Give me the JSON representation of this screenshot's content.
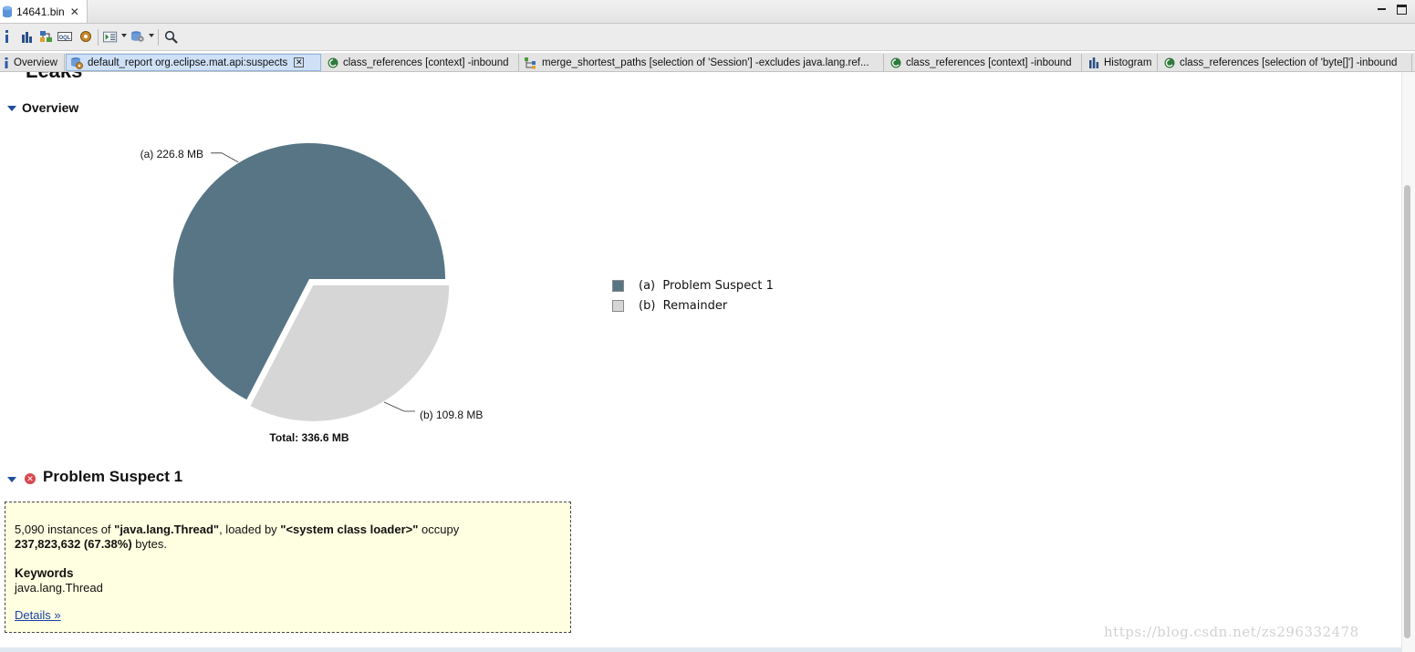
{
  "editor": {
    "tab_title": "14641.bin"
  },
  "toolbar": {
    "info_icon": "info-icon",
    "items": [
      "histogram-icon",
      "dominator-tree-icon",
      "oql-icon",
      "heap-dump-overview-icon",
      "run-report-icon",
      "query-browser-icon",
      "search-icon"
    ]
  },
  "subtabs": [
    {
      "label": "Overview",
      "icon": "info-icon",
      "active": false
    },
    {
      "label": "default_report  org.eclipse.mat.api:suspects",
      "icon": "report-gear-icon",
      "active": true
    },
    {
      "label": "class_references [context] -inbound",
      "icon": "class-icon",
      "active": false
    },
    {
      "label": "merge_shortest_paths [selection of 'Session'] -excludes java.lang.ref...",
      "icon": "tree-icon",
      "active": false
    },
    {
      "label": "class_references [context] -inbound",
      "icon": "class-icon",
      "active": false
    },
    {
      "label": "Histogram",
      "icon": "histogram-icon",
      "active": false
    },
    {
      "label": "class_references [selection of 'byte[]'] -inbound",
      "icon": "class-icon",
      "active": false
    }
  ],
  "report": {
    "leaks_title": "Leaks",
    "overview_title": "Overview",
    "chart_data": {
      "type": "pie",
      "title": "",
      "total_label": "Total: 336.6 MB",
      "slices": [
        {
          "key": "(a)",
          "name": "Problem Suspect 1",
          "value": 226.8,
          "label": "(a)  226.8 MB",
          "color": "#587585"
        },
        {
          "key": "(b)",
          "name": "Remainder",
          "value": 109.8,
          "label": "(b)  109.8 MB",
          "color": "#d6d6d6"
        }
      ],
      "unit": "MB",
      "legend_placement": "right"
    },
    "legend": [
      {
        "key": "(a)",
        "name": "Problem Suspect 1",
        "color": "#587585"
      },
      {
        "key": "(b)",
        "name": "Remainder",
        "color": "#d6d6d6"
      }
    ],
    "suspect": {
      "title": "Problem Suspect 1",
      "instances": "5,090",
      "text_instances_of": " instances of ",
      "class_name": "\"java.lang.Thread\"",
      "text_loaded_by": ", loaded by ",
      "loader": "\"<system class loader>\"",
      "text_occupy": " occupy",
      "bytes": "237,823,632 (67.38%)",
      "text_bytes": " bytes.",
      "keywords_title": "Keywords",
      "keyword": "java.lang.Thread",
      "details_link": "Details »"
    },
    "watermark": "https://blog.csdn.net/zs296332478"
  }
}
